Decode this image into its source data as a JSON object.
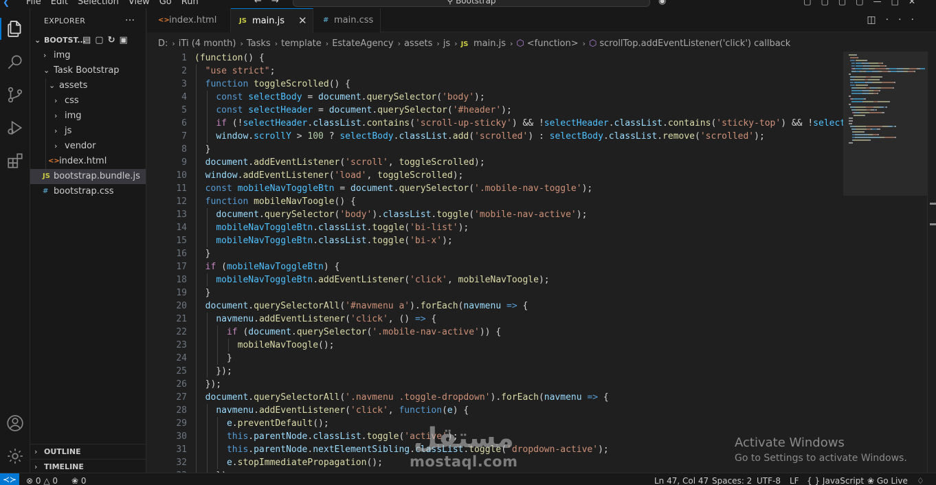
{
  "titlebar": {
    "menu": [
      "File",
      "Edit",
      "Selection",
      "View",
      "Go",
      "Run"
    ],
    "search": "Bootstrap"
  },
  "sidebar": {
    "title": "EXPLORER",
    "root": "BOOTST...",
    "tree": [
      {
        "label": "img",
        "type": "folder",
        "depth": 1,
        "open": false
      },
      {
        "label": "Task Bootstrap",
        "type": "folder",
        "depth": 1,
        "open": true
      },
      {
        "label": "assets",
        "type": "folder",
        "depth": 2,
        "open": true
      },
      {
        "label": "css",
        "type": "folder",
        "depth": 3,
        "open": false
      },
      {
        "label": "img",
        "type": "folder",
        "depth": 3,
        "open": false
      },
      {
        "label": "js",
        "type": "folder",
        "depth": 3,
        "open": false
      },
      {
        "label": "vendor",
        "type": "folder",
        "depth": 3,
        "open": false
      },
      {
        "label": "index.html",
        "type": "html",
        "depth": 2
      },
      {
        "label": "bootstrap.bundle.js",
        "type": "js",
        "depth": 1,
        "selected": true
      },
      {
        "label": "bootstrap.css",
        "type": "css",
        "depth": 1
      }
    ],
    "outline": "OUTLINE",
    "timeline": "TIMELINE"
  },
  "tabs": [
    {
      "label": "index.html",
      "icon": "html",
      "active": false
    },
    {
      "label": "main.js",
      "icon": "js",
      "active": true
    },
    {
      "label": "main.css",
      "icon": "css",
      "active": false
    }
  ],
  "breadcrumb": [
    "D:",
    "iTi (4 month)",
    "Tasks",
    "template",
    "EstateAgency",
    "assets",
    "js",
    "main.js",
    "<function>",
    "scrollTop.addEventListener('click') callback"
  ],
  "code": {
    "lines": [
      [
        [
          "(function",
          "fn"
        ],
        [
          "() {",
          "p"
        ]
      ],
      [
        [
          "  ",
          "p"
        ],
        [
          "\"use strict\"",
          "str"
        ],
        [
          ";",
          "p"
        ]
      ],
      [
        [
          "  ",
          "p"
        ],
        [
          "function",
          "kw"
        ],
        [
          " ",
          "p"
        ],
        [
          "toggleScrolled",
          "fn"
        ],
        [
          "() {",
          "p"
        ]
      ],
      [
        [
          "    ",
          "p"
        ],
        [
          "const",
          "kw"
        ],
        [
          " ",
          "p"
        ],
        [
          "selectBody",
          "cv"
        ],
        [
          " = ",
          "p"
        ],
        [
          "document",
          "var"
        ],
        [
          ".",
          "p"
        ],
        [
          "querySelector",
          "fn"
        ],
        [
          "(",
          "p"
        ],
        [
          "'body'",
          "str"
        ],
        [
          ");",
          "p"
        ]
      ],
      [
        [
          "    ",
          "p"
        ],
        [
          "const",
          "kw"
        ],
        [
          " ",
          "p"
        ],
        [
          "selectHeader",
          "cv"
        ],
        [
          " = ",
          "p"
        ],
        [
          "document",
          "var"
        ],
        [
          ".",
          "p"
        ],
        [
          "querySelector",
          "fn"
        ],
        [
          "(",
          "p"
        ],
        [
          "'#header'",
          "str"
        ],
        [
          ");",
          "p"
        ]
      ],
      [
        [
          "    ",
          "p"
        ],
        [
          "if",
          "ctl"
        ],
        [
          " (!",
          "p"
        ],
        [
          "selectHeader",
          "cv"
        ],
        [
          ".",
          "p"
        ],
        [
          "classList",
          "var"
        ],
        [
          ".",
          "p"
        ],
        [
          "contains",
          "fn"
        ],
        [
          "(",
          "p"
        ],
        [
          "'scroll-up-sticky'",
          "str"
        ],
        [
          ") && !",
          "p"
        ],
        [
          "selectHeader",
          "cv"
        ],
        [
          ".",
          "p"
        ],
        [
          "classList",
          "var"
        ],
        [
          ".",
          "p"
        ],
        [
          "contains",
          "fn"
        ],
        [
          "(",
          "p"
        ],
        [
          "'sticky-top'",
          "str"
        ],
        [
          ") && !",
          "p"
        ],
        [
          "selectHe",
          "cv"
        ]
      ],
      [
        [
          "    ",
          "p"
        ],
        [
          "window",
          "var"
        ],
        [
          ".",
          "p"
        ],
        [
          "scrollY",
          "cv"
        ],
        [
          " > ",
          "p"
        ],
        [
          "100",
          "num"
        ],
        [
          " ? ",
          "p"
        ],
        [
          "selectBody",
          "cv"
        ],
        [
          ".",
          "p"
        ],
        [
          "classList",
          "var"
        ],
        [
          ".",
          "p"
        ],
        [
          "add",
          "fn"
        ],
        [
          "(",
          "p"
        ],
        [
          "'scrolled'",
          "str"
        ],
        [
          ") : ",
          "p"
        ],
        [
          "selectBody",
          "cv"
        ],
        [
          ".",
          "p"
        ],
        [
          "classList",
          "var"
        ],
        [
          ".",
          "p"
        ],
        [
          "remove",
          "fn"
        ],
        [
          "(",
          "p"
        ],
        [
          "'scrolled'",
          "str"
        ],
        [
          ");",
          "p"
        ]
      ],
      [
        [
          "  }",
          "p"
        ]
      ],
      [
        [
          "  ",
          "p"
        ],
        [
          "document",
          "var"
        ],
        [
          ".",
          "p"
        ],
        [
          "addEventListener",
          "fn"
        ],
        [
          "(",
          "p"
        ],
        [
          "'scroll'",
          "str"
        ],
        [
          ", ",
          "p"
        ],
        [
          "toggleScrolled",
          "fn"
        ],
        [
          ");",
          "p"
        ]
      ],
      [
        [
          "  ",
          "p"
        ],
        [
          "window",
          "var"
        ],
        [
          ".",
          "p"
        ],
        [
          "addEventListener",
          "fn"
        ],
        [
          "(",
          "p"
        ],
        [
          "'load'",
          "str"
        ],
        [
          ", ",
          "p"
        ],
        [
          "toggleScrolled",
          "fn"
        ],
        [
          ");",
          "p"
        ]
      ],
      [
        [
          "  ",
          "p"
        ],
        [
          "const",
          "kw"
        ],
        [
          " ",
          "p"
        ],
        [
          "mobileNavToggleBtn",
          "cv"
        ],
        [
          " = ",
          "p"
        ],
        [
          "document",
          "var"
        ],
        [
          ".",
          "p"
        ],
        [
          "querySelector",
          "fn"
        ],
        [
          "(",
          "p"
        ],
        [
          "'.mobile-nav-toggle'",
          "str"
        ],
        [
          ");",
          "p"
        ]
      ],
      [
        [
          "  ",
          "p"
        ],
        [
          "function",
          "kw"
        ],
        [
          " ",
          "p"
        ],
        [
          "mobileNavToogle",
          "fn"
        ],
        [
          "() {",
          "p"
        ]
      ],
      [
        [
          "    ",
          "p"
        ],
        [
          "document",
          "var"
        ],
        [
          ".",
          "p"
        ],
        [
          "querySelector",
          "fn"
        ],
        [
          "(",
          "p"
        ],
        [
          "'body'",
          "str"
        ],
        [
          ").",
          "p"
        ],
        [
          "classList",
          "var"
        ],
        [
          ".",
          "p"
        ],
        [
          "toggle",
          "fn"
        ],
        [
          "(",
          "p"
        ],
        [
          "'mobile-nav-active'",
          "str"
        ],
        [
          ");",
          "p"
        ]
      ],
      [
        [
          "    ",
          "p"
        ],
        [
          "mobileNavToggleBtn",
          "cv"
        ],
        [
          ".",
          "p"
        ],
        [
          "classList",
          "var"
        ],
        [
          ".",
          "p"
        ],
        [
          "toggle",
          "fn"
        ],
        [
          "(",
          "p"
        ],
        [
          "'bi-list'",
          "str"
        ],
        [
          ");",
          "p"
        ]
      ],
      [
        [
          "    ",
          "p"
        ],
        [
          "mobileNavToggleBtn",
          "cv"
        ],
        [
          ".",
          "p"
        ],
        [
          "classList",
          "var"
        ],
        [
          ".",
          "p"
        ],
        [
          "toggle",
          "fn"
        ],
        [
          "(",
          "p"
        ],
        [
          "'bi-x'",
          "str"
        ],
        [
          ");",
          "p"
        ]
      ],
      [
        [
          "  }",
          "p"
        ]
      ],
      [
        [
          "  ",
          "p"
        ],
        [
          "if",
          "ctl"
        ],
        [
          " (",
          "p"
        ],
        [
          "mobileNavToggleBtn",
          "cv"
        ],
        [
          ") {",
          "p"
        ]
      ],
      [
        [
          "    ",
          "p"
        ],
        [
          "mobileNavToggleBtn",
          "cv"
        ],
        [
          ".",
          "p"
        ],
        [
          "addEventListener",
          "fn"
        ],
        [
          "(",
          "p"
        ],
        [
          "'click'",
          "str"
        ],
        [
          ", ",
          "p"
        ],
        [
          "mobileNavToogle",
          "fn"
        ],
        [
          ");",
          "p"
        ]
      ],
      [
        [
          "  }",
          "p"
        ]
      ],
      [
        [
          "  ",
          "p"
        ],
        [
          "document",
          "var"
        ],
        [
          ".",
          "p"
        ],
        [
          "querySelectorAll",
          "fn"
        ],
        [
          "(",
          "p"
        ],
        [
          "'#navmenu a'",
          "str"
        ],
        [
          ").",
          "p"
        ],
        [
          "forEach",
          "fn"
        ],
        [
          "(",
          "p"
        ],
        [
          "navmenu",
          "var"
        ],
        [
          " ",
          "p"
        ],
        [
          "=>",
          "kw"
        ],
        [
          " {",
          "p"
        ]
      ],
      [
        [
          "    ",
          "p"
        ],
        [
          "navmenu",
          "var"
        ],
        [
          ".",
          "p"
        ],
        [
          "addEventListener",
          "fn"
        ],
        [
          "(",
          "p"
        ],
        [
          "'click'",
          "str"
        ],
        [
          ", () ",
          "p"
        ],
        [
          "=>",
          "kw"
        ],
        [
          " {",
          "p"
        ]
      ],
      [
        [
          "      ",
          "p"
        ],
        [
          "if",
          "ctl"
        ],
        [
          " (",
          "p"
        ],
        [
          "document",
          "var"
        ],
        [
          ".",
          "p"
        ],
        [
          "querySelector",
          "fn"
        ],
        [
          "(",
          "p"
        ],
        [
          "'.mobile-nav-active'",
          "str"
        ],
        [
          ")) {",
          "p"
        ]
      ],
      [
        [
          "        ",
          "p"
        ],
        [
          "mobileNavToogle",
          "fn"
        ],
        [
          "();",
          "p"
        ]
      ],
      [
        [
          "      }",
          "p"
        ]
      ],
      [
        [
          "    });",
          "p"
        ]
      ],
      [
        [
          "  });",
          "p"
        ]
      ],
      [
        [
          "  ",
          "p"
        ],
        [
          "document",
          "var"
        ],
        [
          ".",
          "p"
        ],
        [
          "querySelectorAll",
          "fn"
        ],
        [
          "(",
          "p"
        ],
        [
          "'.navmenu .toggle-dropdown'",
          "str"
        ],
        [
          ").",
          "p"
        ],
        [
          "forEach",
          "fn"
        ],
        [
          "(",
          "p"
        ],
        [
          "navmenu",
          "var"
        ],
        [
          " ",
          "p"
        ],
        [
          "=>",
          "kw"
        ],
        [
          " {",
          "p"
        ]
      ],
      [
        [
          "    ",
          "p"
        ],
        [
          "navmenu",
          "var"
        ],
        [
          ".",
          "p"
        ],
        [
          "addEventListener",
          "fn"
        ],
        [
          "(",
          "p"
        ],
        [
          "'click'",
          "str"
        ],
        [
          ", ",
          "p"
        ],
        [
          "function",
          "kw"
        ],
        [
          "(",
          "p"
        ],
        [
          "e",
          "var"
        ],
        [
          ") {",
          "p"
        ]
      ],
      [
        [
          "      ",
          "p"
        ],
        [
          "e",
          "var"
        ],
        [
          ".",
          "p"
        ],
        [
          "preventDefault",
          "fn"
        ],
        [
          "();",
          "p"
        ]
      ],
      [
        [
          "      ",
          "p"
        ],
        [
          "this",
          "kw"
        ],
        [
          ".",
          "p"
        ],
        [
          "parentNode",
          "var"
        ],
        [
          ".",
          "p"
        ],
        [
          "classList",
          "var"
        ],
        [
          ".",
          "p"
        ],
        [
          "toggle",
          "fn"
        ],
        [
          "(",
          "p"
        ],
        [
          "'active'",
          "str"
        ],
        [
          ");",
          "p"
        ]
      ],
      [
        [
          "      ",
          "p"
        ],
        [
          "this",
          "kw"
        ],
        [
          ".",
          "p"
        ],
        [
          "parentNode",
          "var"
        ],
        [
          ".",
          "p"
        ],
        [
          "nextElementSibling",
          "var"
        ],
        [
          ".",
          "p"
        ],
        [
          "classList",
          "var"
        ],
        [
          ".",
          "p"
        ],
        [
          "toggle",
          "fn"
        ],
        [
          "(",
          "p"
        ],
        [
          "'dropdown-active'",
          "str"
        ],
        [
          ");",
          "p"
        ]
      ],
      [
        [
          "      ",
          "p"
        ],
        [
          "e",
          "var"
        ],
        [
          ".",
          "p"
        ],
        [
          "stopImmediatePropagation",
          "fn"
        ],
        [
          "();",
          "p"
        ]
      ],
      [
        [
          "    });",
          "p"
        ]
      ]
    ],
    "colors": {
      "kw": "#569cd6",
      "ctl": "#c586c0",
      "fn": "#dcdcaa",
      "var": "#9cdcfe",
      "cv": "#4fc1ff",
      "str": "#ce9178",
      "num": "#b5cea8",
      "p": "#d4d4d4"
    }
  },
  "watermark": {
    "activate_title": "Activate Windows",
    "activate_sub": "Go to Settings to activate Windows.",
    "brand_ar": "مستقل",
    "brand_en": "mostaql.com"
  },
  "statusbar": {
    "errors": "0",
    "warnings": "0",
    "ports": "0",
    "position": "Ln 47, Col 47",
    "spaces": "Spaces: 2",
    "encoding": "UTF-8",
    "eol": "LF",
    "language": "JavaScript",
    "golive": "Go Live"
  }
}
